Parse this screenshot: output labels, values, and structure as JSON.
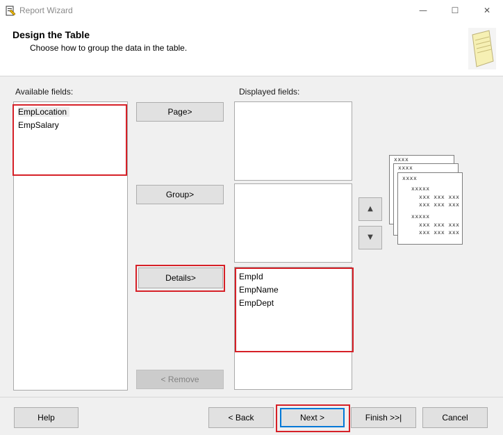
{
  "window": {
    "title": "Report Wizard",
    "minimize_glyph": "—",
    "maximize_glyph": "☐",
    "close_glyph": "✕"
  },
  "header": {
    "title": "Design the Table",
    "subtitle": "Choose how to group the data in the table."
  },
  "available": {
    "label": "Available fields:",
    "items": [
      "EmpLocation",
      "EmpSalary"
    ]
  },
  "displayed": {
    "label": "Displayed fields:",
    "page_items": [],
    "group_items": [],
    "details_items": [
      "EmpId",
      "EmpName",
      "EmpDept"
    ]
  },
  "buttons": {
    "page": "Page>",
    "group": "Group>",
    "details": "Details>",
    "remove": "< Remove",
    "move_up": "▲",
    "move_down": "▼",
    "help": "Help",
    "back": "< Back",
    "next": "Next >",
    "finish": "Finish >>|",
    "cancel": "Cancel"
  },
  "preview": {
    "group_marker": "xxxx",
    "sub_marker": "xxxxx",
    "row_text": "xxx xxx xxx"
  }
}
